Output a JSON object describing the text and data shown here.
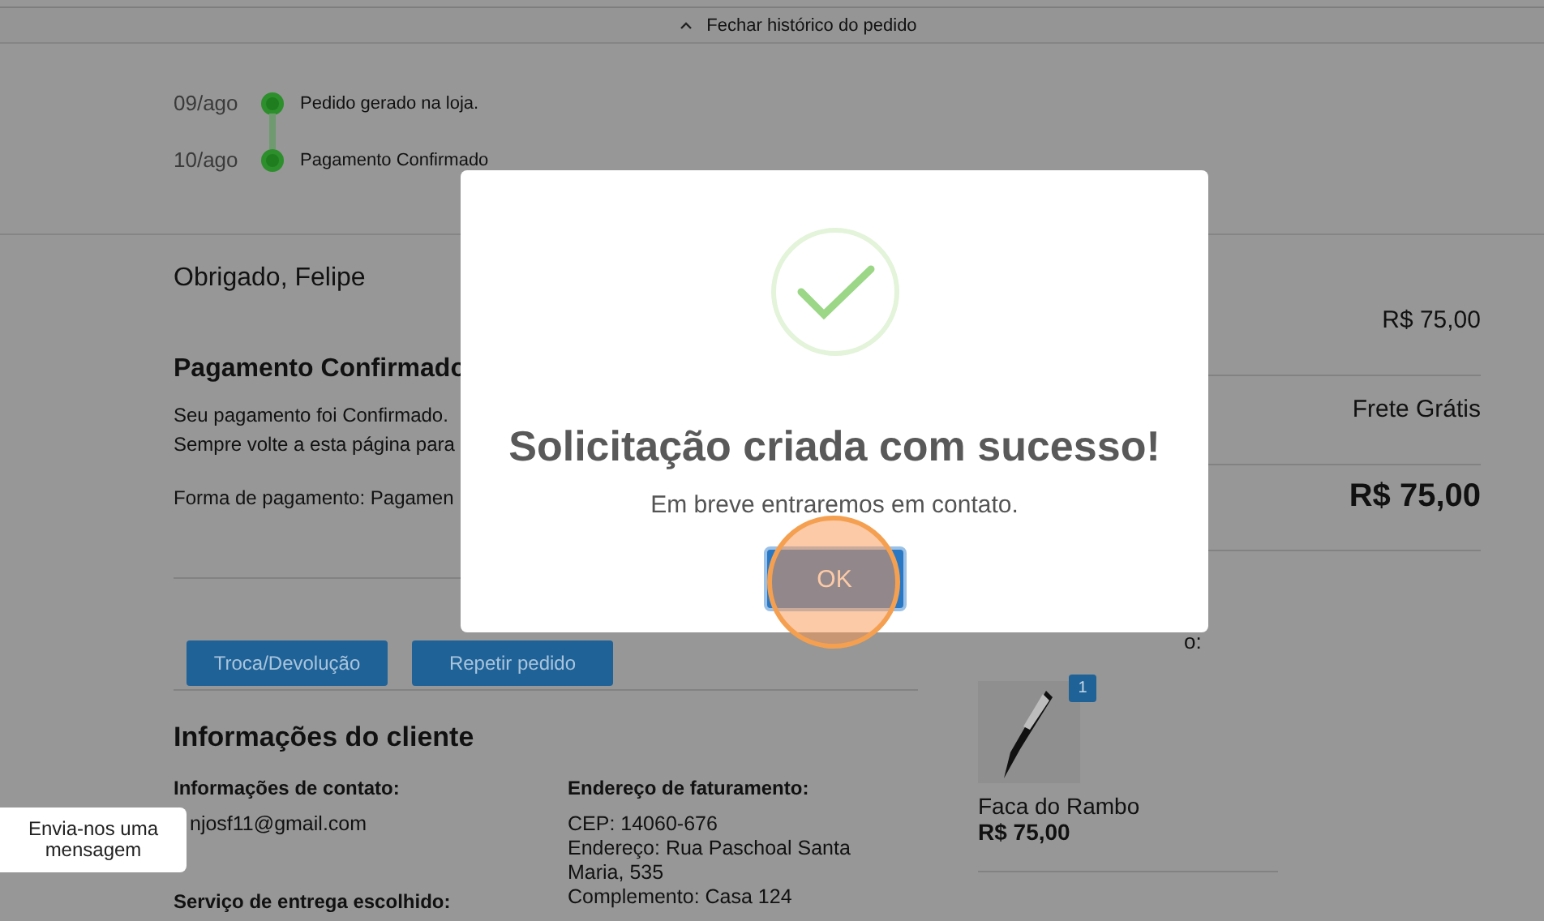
{
  "history_toggle": {
    "label": "Fechar histórico do pedido"
  },
  "timeline": [
    {
      "date": "09/ago",
      "event": "Pedido gerado na loja."
    },
    {
      "date": "10/ago",
      "event": "Pagamento Confirmado"
    }
  ],
  "greeting": "Obrigado, Felipe",
  "payment": {
    "title": "Pagamento Confirmado",
    "lines": [
      "Seu pagamento foi Confirmado.",
      "Sempre volte a esta página para"
    ],
    "method": "Forma de pagamento: Pagamen"
  },
  "actions": [
    "Troca/Devolução",
    "Repetir pedido"
  ],
  "customer": {
    "title": "Informações do cliente",
    "contact_label": "Informações de contato:",
    "email": "njosf11@gmail.com",
    "shipping_label": "Serviço de entrega escolhido:",
    "billing_label": "Endereço de faturamento:",
    "billing_lines": [
      "CEP: 14060-676",
      "Endereço: Rua Paschoal Santa Maria, 535",
      "Complemento: Casa 124"
    ]
  },
  "summary": {
    "subtotal": "R$ 75,00",
    "shipping": "Frete Grátis",
    "total": "R$ 75,00",
    "items_label": "o:",
    "items": [
      {
        "name": "Faca do Rambo",
        "price": "R$ 75,00",
        "quantity": "1"
      }
    ]
  },
  "chat": {
    "label": "Envia-nos uma mensagem"
  },
  "modal": {
    "title": "Solicitação criada com sucesso!",
    "message": "Em breve entraremos em contato.",
    "button": "OK"
  }
}
